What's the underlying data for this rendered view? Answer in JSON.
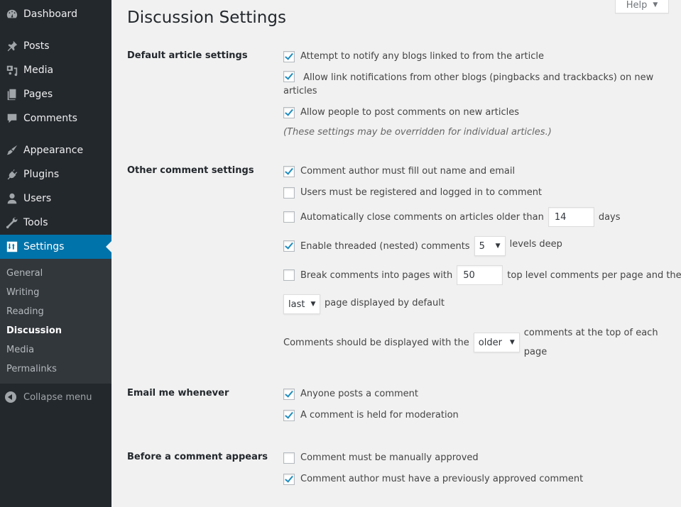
{
  "sidebar": {
    "items": [
      {
        "label": "Dashboard",
        "icon": "dashboard-icon"
      },
      {
        "label": "Posts",
        "icon": "pin-icon"
      },
      {
        "label": "Media",
        "icon": "media-icon"
      },
      {
        "label": "Pages",
        "icon": "pages-icon"
      },
      {
        "label": "Comments",
        "icon": "comment-icon"
      },
      {
        "label": "Appearance",
        "icon": "paintbrush-icon"
      },
      {
        "label": "Plugins",
        "icon": "plug-icon"
      },
      {
        "label": "Users",
        "icon": "user-icon"
      },
      {
        "label": "Tools",
        "icon": "wrench-icon"
      },
      {
        "label": "Settings",
        "icon": "settings-icon",
        "active": true
      }
    ],
    "submenu": [
      "General",
      "Writing",
      "Reading",
      "Discussion",
      "Media",
      "Permalinks"
    ],
    "submenu_current": "Discussion",
    "collapse_label": "Collapse menu"
  },
  "header": {
    "help_label": "Help",
    "title": "Discussion Settings"
  },
  "sections": {
    "default_article": {
      "label": "Default article settings",
      "options": [
        {
          "label": "Attempt to notify any blogs linked to from the article",
          "checked": true
        },
        {
          "label": "Allow link notifications from other blogs (pingbacks and trackbacks) on new articles",
          "checked": true
        },
        {
          "label": "Allow people to post comments on new articles",
          "checked": true
        }
      ],
      "note": "(These settings may be overridden for individual articles.)"
    },
    "other_comment": {
      "label": "Other comment settings",
      "require_name_email": {
        "label": "Comment author must fill out name and email",
        "checked": true
      },
      "registered_only": {
        "label": "Users must be registered and logged in to comment",
        "checked": false
      },
      "auto_close": {
        "label": "Automatically close comments on articles older than",
        "checked": false,
        "value": "14",
        "suffix": "days"
      },
      "threaded": {
        "label": "Enable threaded (nested) comments",
        "checked": true,
        "value": "5",
        "suffix": "levels deep"
      },
      "paged": {
        "label": "Break comments into pages with",
        "checked": false,
        "value": "50",
        "suffix": "top level comments per page and the"
      },
      "default_page": {
        "value": "last",
        "suffix": "page displayed by default"
      },
      "order": {
        "prefix": "Comments should be displayed with the",
        "value": "older",
        "suffix": "comments at the top of each page"
      }
    },
    "email": {
      "label": "Email me whenever",
      "options": [
        {
          "label": "Anyone posts a comment",
          "checked": true
        },
        {
          "label": "A comment is held for moderation",
          "checked": true
        }
      ]
    },
    "before_appears": {
      "label": "Before a comment appears",
      "options": [
        {
          "label": "Comment must be manually approved",
          "checked": false
        },
        {
          "label": "Comment author must have a previously approved comment",
          "checked": true
        }
      ]
    }
  },
  "colors": {
    "sidebar_bg": "#23282d",
    "submenu_bg": "#32373c",
    "accent": "#0073aa",
    "check": "#1e8cbe",
    "page_bg": "#f1f1f1"
  }
}
